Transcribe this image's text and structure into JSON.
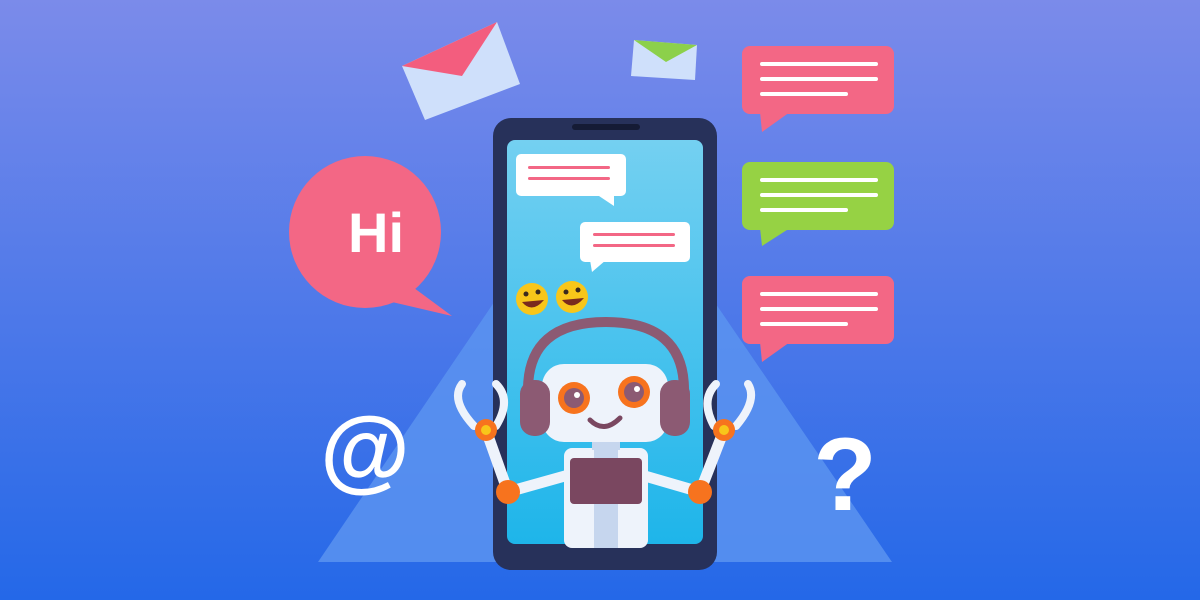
{
  "texts": {
    "hi": "Hi",
    "at": "@",
    "question": "?"
  },
  "colors": {
    "bg_top": "#7b8bea",
    "bg_bottom": "#2468e8",
    "triangle": "#5b93f0",
    "phone_frame": "#27315a",
    "screen_top": "#74d0f1",
    "screen_bottom": "#1eb5ea",
    "pink_bubble": "#f36785",
    "green_bubble": "#96d244",
    "robot_white": "#eef3fb",
    "robot_purple": "#8c5a73",
    "robot_orange": "#f7731e",
    "emoji_yellow": "#f8c61a",
    "envelope_pink": "#f35d7e",
    "envelope_green": "#8cd04b",
    "envelope_body": "#cfe0fb"
  },
  "icons": [
    "envelope-icon",
    "envelope-icon",
    "chat-bubble-icon",
    "emoji-icon",
    "robot-icon",
    "smartphone-icon",
    "at-sign-icon",
    "question-mark-icon"
  ]
}
